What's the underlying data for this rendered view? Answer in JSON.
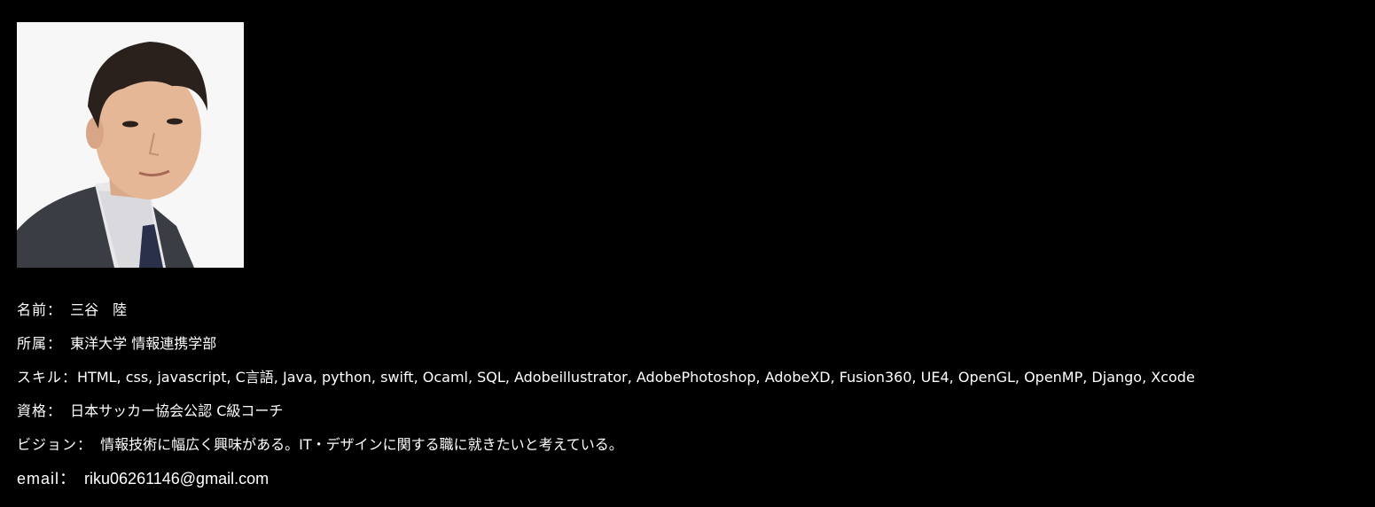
{
  "profile": {
    "photo_icon": "person-portrait-icon",
    "name": {
      "label": "名前：",
      "value": "三谷　陸"
    },
    "affiliation": {
      "label": "所属：",
      "value": "東洋大学 情報連携学部"
    },
    "skills": {
      "label": "スキル：",
      "value": "HTML, css, javascript, C言語, Java, python, swift, Ocaml, SQL, Adobeillustrator, AdobePhotoshop, AdobeXD, Fusion360, UE4, OpenGL, OpenMP, Django, Xcode"
    },
    "qualification": {
      "label": "資格：",
      "value": "日本サッカー協会公認 C級コーチ"
    },
    "vision": {
      "label": "ビジョン：",
      "value": "情報技術に幅広く興味がある。IT・デザインに関する職に就きたいと考えている。"
    },
    "email": {
      "label": "email：",
      "value": "riku06261146@gmail.com"
    }
  },
  "colors": {
    "background": "#000000",
    "text": "#ffffff",
    "photo_background": "#f7f7f7"
  }
}
